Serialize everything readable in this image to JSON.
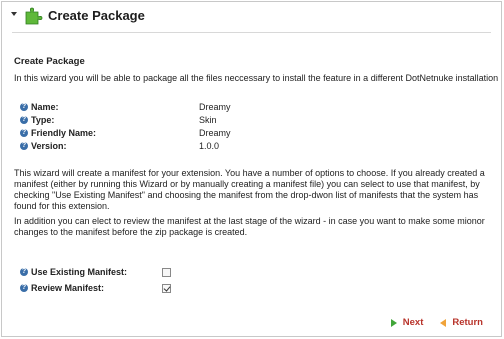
{
  "header": {
    "title": "Create Package",
    "icon": "puzzle-piece-icon"
  },
  "section": {
    "title": "Create Package",
    "intro": "In this wizard you will be able to package all the files neccessary to install the feature in a different DotNetnuke installation"
  },
  "properties": [
    {
      "label": "Name:",
      "value": "Dreamy"
    },
    {
      "label": "Type:",
      "value": "Skin"
    },
    {
      "label": "Friendly Name:",
      "value": "Dreamy"
    },
    {
      "label": "Version:",
      "value": "1.0.0"
    }
  ],
  "paragraphs": [
    "This wizard will create a manifest for your extension. You have a number of options to choose. If you already created a manifest (either by running this Wizard or by manually creating a manifest file) you can select to use that manifest, by checking \"Use Existing Manifest\" and choosing the manifest from the drop-dwon list of manifests that the system has found for this extension.",
    "In addition you can elect to review the manifest at the last stage of the wizard - in case you want to make some mionor changes to the manifest before the zip package is created."
  ],
  "options": [
    {
      "label": "Use Existing Manifest:",
      "checked": false
    },
    {
      "label": "Review Manifest:",
      "checked": true
    }
  ],
  "actions": {
    "next_label": "Next",
    "return_label": "Return"
  },
  "colors": {
    "accent_link": "#b8332a",
    "help_icon": "#3a6ea8",
    "next_arrow": "#42a63a",
    "return_arrow": "#f0a33a"
  }
}
